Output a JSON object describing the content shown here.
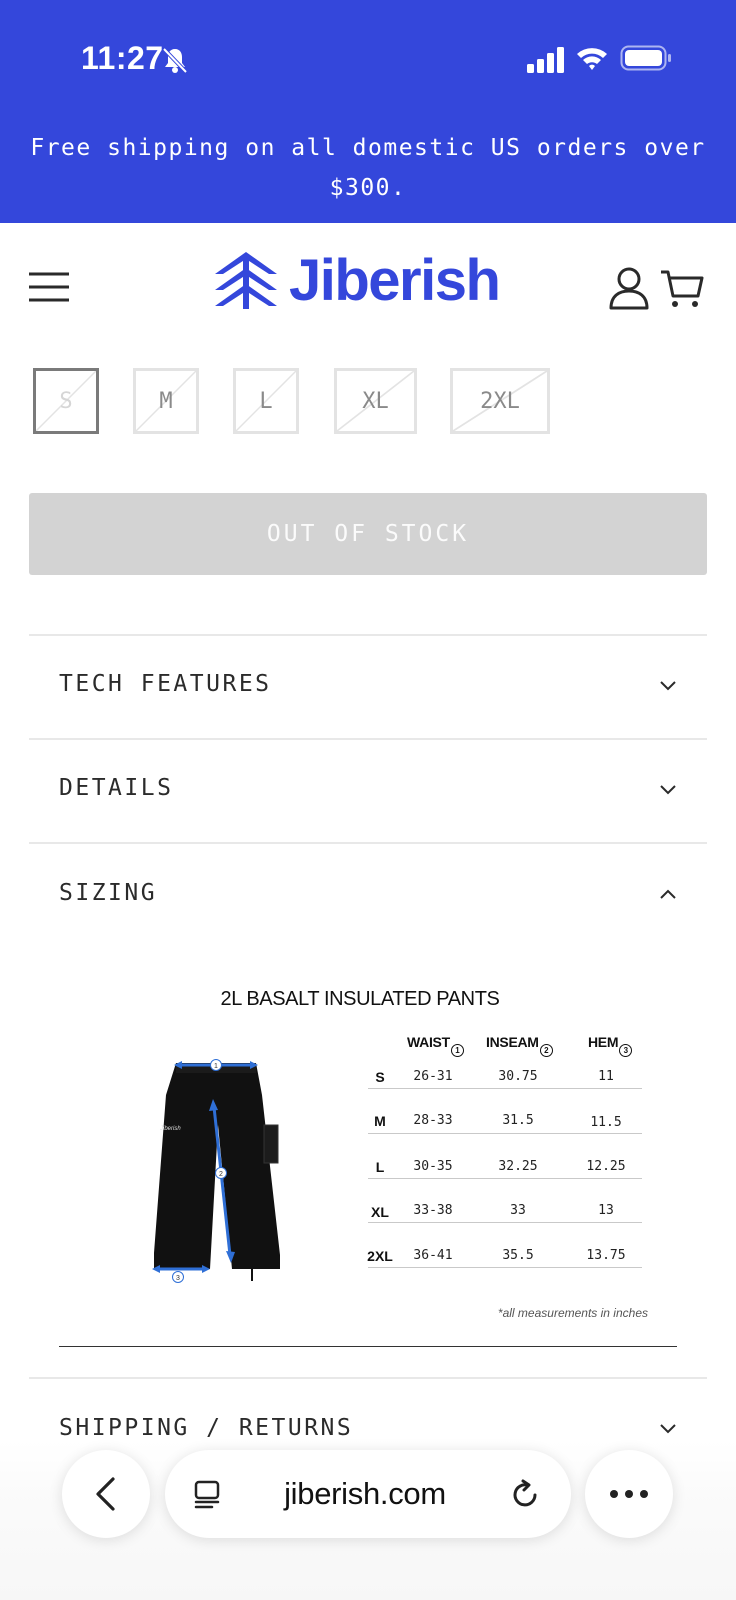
{
  "status_bar": {
    "time": "11:27"
  },
  "promo": {
    "text": "Free shipping on all domestic US orders over $300."
  },
  "brand": {
    "name": "Jiberish",
    "color": "#3447db"
  },
  "sizes": [
    {
      "label": "S",
      "selected": true,
      "available": false
    },
    {
      "label": "M",
      "selected": false,
      "available": false
    },
    {
      "label": "L",
      "selected": false,
      "available": false
    },
    {
      "label": "XL",
      "selected": false,
      "available": false
    },
    {
      "label": "2XL",
      "selected": false,
      "available": false
    }
  ],
  "stock_button": {
    "label": "OUT OF STOCK"
  },
  "accordion": {
    "tech_features": "TECH FEATURES",
    "details": "DETAILS",
    "sizing": "SIZING",
    "shipping": "SHIPPING / RETURNS"
  },
  "size_chart": {
    "title": "2L BASALT INSULATED PANTS",
    "columns": [
      "WAIST",
      "INSEAM",
      "HEM"
    ],
    "markers": [
      "1",
      "2",
      "3"
    ],
    "rows": [
      {
        "size": "S",
        "waist": "26-31",
        "inseam": "30.75",
        "hem": "11"
      },
      {
        "size": "M",
        "waist": "28-33",
        "inseam": "31.5",
        "hem": "11.5"
      },
      {
        "size": "L",
        "waist": "30-35",
        "inseam": "32.25",
        "hem": "12.25"
      },
      {
        "size": "XL",
        "waist": "33-38",
        "inseam": "33",
        "hem": "13"
      },
      {
        "size": "2XL",
        "waist": "36-41",
        "inseam": "35.5",
        "hem": "13.75"
      }
    ],
    "footnote": "*all measurements in inches"
  },
  "browser": {
    "url": "jiberish.com"
  },
  "icons": [
    "bell-slash-icon",
    "signal-icon",
    "wifi-icon",
    "battery-icon",
    "hamburger-icon",
    "logo-mark-icon",
    "account-icon",
    "cart-icon",
    "chevron-down-icon",
    "chevron-up-icon",
    "back-icon",
    "tabs-icon",
    "reload-icon",
    "more-icon"
  ]
}
